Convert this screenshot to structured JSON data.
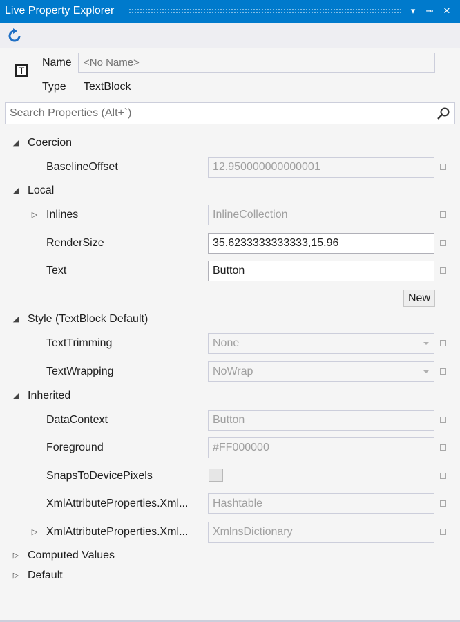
{
  "window": {
    "title": "Live Property Explorer",
    "dropdown_glyph": "▾",
    "pin_glyph": "⊸",
    "close_glyph": "✕"
  },
  "header": {
    "element_icon": "T",
    "name_label": "Name",
    "name_placeholder": "<No Name>",
    "type_label": "Type",
    "type_value": "TextBlock"
  },
  "search": {
    "placeholder": "Search Properties (Alt+`)"
  },
  "glyphs": {
    "expanded": "◢",
    "collapsed": "▷"
  },
  "categories": {
    "coercion": {
      "label": "Coercion",
      "baseline_offset": {
        "name": "BaselineOffset",
        "value": "12.950000000000001"
      }
    },
    "local": {
      "label": "Local",
      "inlines": {
        "name": "Inlines",
        "value": "InlineCollection"
      },
      "render_size": {
        "name": "RenderSize",
        "value": "35.6233333333333,15.96"
      },
      "text": {
        "name": "Text",
        "value": "Button"
      },
      "new_button": "New"
    },
    "style": {
      "label": "Style (TextBlock Default)",
      "text_trimming": {
        "name": "TextTrimming",
        "value": "None"
      },
      "text_wrapping": {
        "name": "TextWrapping",
        "value": "NoWrap"
      }
    },
    "inherited": {
      "label": "Inherited",
      "data_context": {
        "name": "DataContext",
        "value": "Button"
      },
      "foreground": {
        "name": "Foreground",
        "value": "#FF000000"
      },
      "snaps": {
        "name": "SnapsToDevicePixels",
        "checked": false
      },
      "xml_attr_1": {
        "name": "XmlAttributeProperties.Xml...",
        "value": "Hashtable"
      },
      "xml_attr_2": {
        "name": "XmlAttributeProperties.Xml...",
        "value": "XmlnsDictionary"
      }
    },
    "computed": {
      "label": "Computed Values"
    },
    "default": {
      "label": "Default"
    }
  },
  "colors": {
    "accent": "#007acc",
    "panel_bg": "#f5f5f5",
    "border": "#cccedb"
  }
}
